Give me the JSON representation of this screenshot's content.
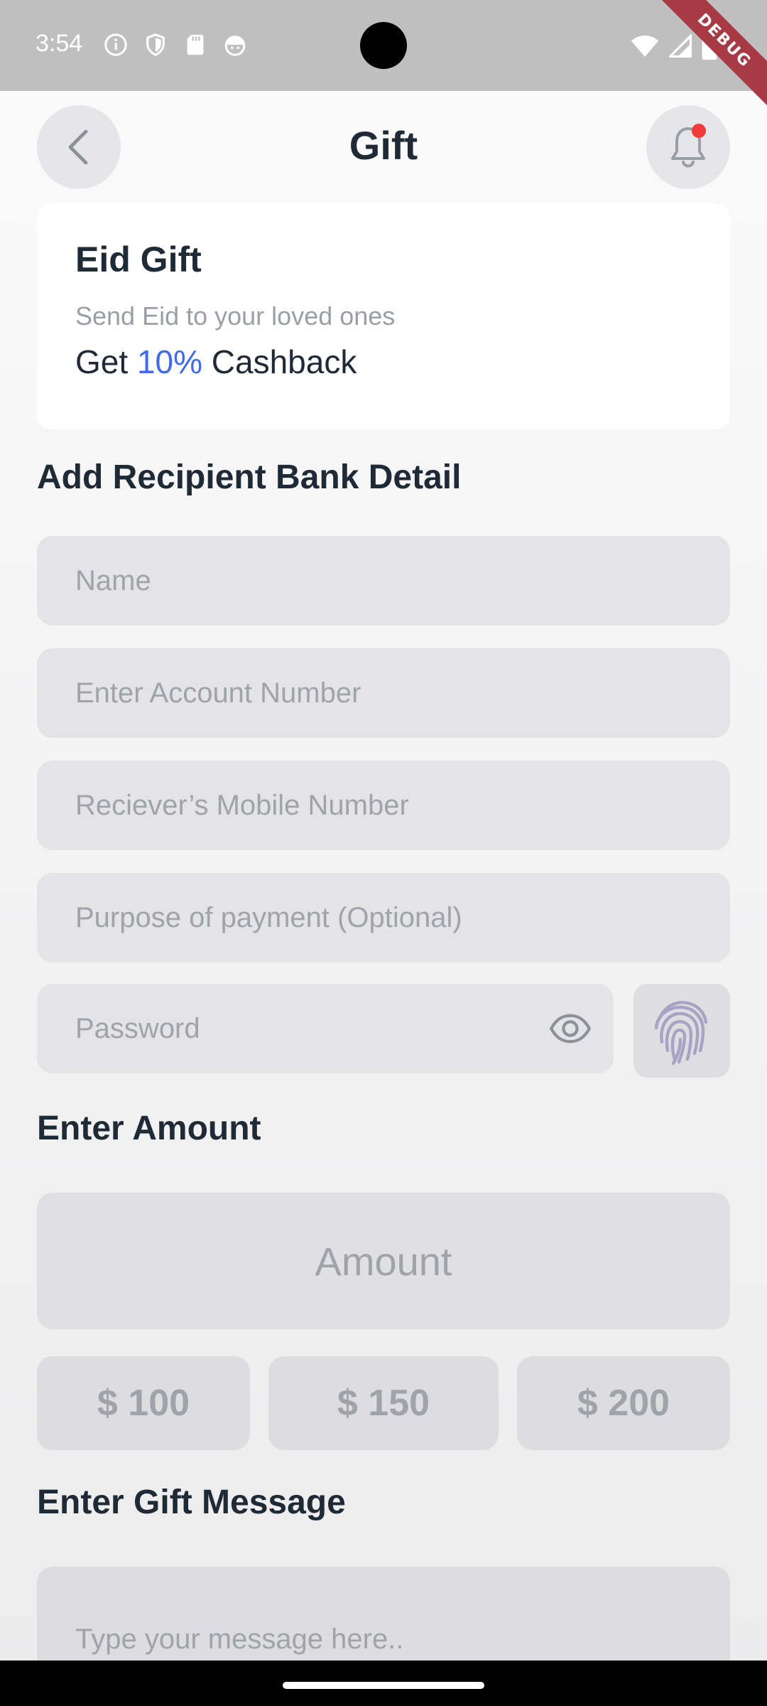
{
  "status_bar": {
    "time": "3:54",
    "left_icons": [
      "info-icon",
      "shield-icon",
      "sd-card-icon",
      "android-icon"
    ],
    "right_icons": [
      "wifi-icon",
      "signal-icon",
      "battery-icon"
    ],
    "debug_label": "DEBUG"
  },
  "header": {
    "title": "Gift",
    "back_icon": "chevron-left-icon",
    "bell_icon": "bell-icon",
    "has_notification": true
  },
  "promo": {
    "title": "Eid Gift",
    "subtitle": "Send Eid to your loved ones",
    "cashback_prefix": "Get",
    "cashback_value": "10%",
    "cashback_suffix": "Cashback"
  },
  "recipient": {
    "section_title": "Add Recipient Bank Detail",
    "name_placeholder": "Name",
    "account_placeholder": "Enter Account Number",
    "mobile_placeholder": "Reciever’s Mobile Number",
    "purpose_placeholder": "Purpose of payment (Optional)",
    "password_placeholder": "Password"
  },
  "amount": {
    "section_title": "Enter Amount",
    "placeholder": "Amount",
    "presets": [
      "$ 100",
      "$ 150",
      "$ 200"
    ]
  },
  "message": {
    "section_title": "Enter Gift Message",
    "placeholder": "Type your message here.."
  },
  "colors": {
    "accent": "#3f6be8",
    "notification": "#ef3b3b",
    "text_primary": "#1f2a37",
    "placeholder": "#a0a3aa",
    "field_bg": "#e4e4e6"
  }
}
